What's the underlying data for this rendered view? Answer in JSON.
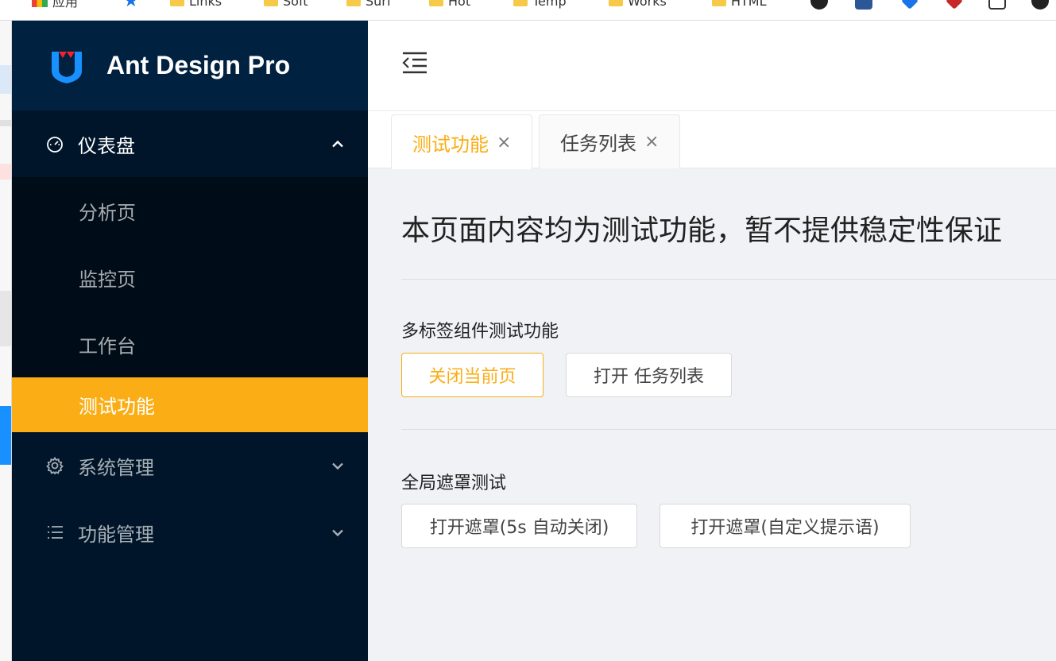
{
  "browser": {
    "bookmarks": [
      {
        "label": "应用",
        "type": "apps"
      },
      {
        "label": "",
        "type": "star"
      },
      {
        "label": "Links",
        "type": "folder"
      },
      {
        "label": "Soft",
        "type": "folder"
      },
      {
        "label": "Surf",
        "type": "folder"
      },
      {
        "label": "Hot",
        "type": "folder"
      },
      {
        "label": "Temp",
        "type": "folder"
      },
      {
        "label": "Works",
        "type": "folder"
      },
      {
        "label": "HTML",
        "type": "folder"
      }
    ]
  },
  "sidebar": {
    "brand": "Ant Design Pro",
    "menu": {
      "dashboard": {
        "label": "仪表盘",
        "icon": "dashboard-icon"
      },
      "sub_items": [
        {
          "label": "分析页"
        },
        {
          "label": "监控页"
        },
        {
          "label": "工作台"
        },
        {
          "label": "测试功能"
        }
      ],
      "system": {
        "label": "系统管理",
        "icon": "gear-icon"
      },
      "features": {
        "label": "功能管理",
        "icon": "list-icon"
      }
    }
  },
  "tabs": [
    {
      "label": "测试功能",
      "close": "×"
    },
    {
      "label": "任务列表",
      "close": "×"
    }
  ],
  "content": {
    "title": "本页面内容均为测试功能，暂不提供稳定性保证",
    "section1": {
      "title": "多标签组件测试功能",
      "close_btn": "关闭当前页",
      "open_btn": "打开 任务列表"
    },
    "section2": {
      "title": "全局遮罩测试",
      "mask_auto_btn": "打开遮罩(5s 自动关闭)",
      "mask_custom_btn": "打开遮罩(自定义提示语)"
    }
  },
  "colors": {
    "sider": "#001529",
    "logo_bg": "#002140",
    "submenu": "#000c17",
    "accent": "#faad14"
  }
}
